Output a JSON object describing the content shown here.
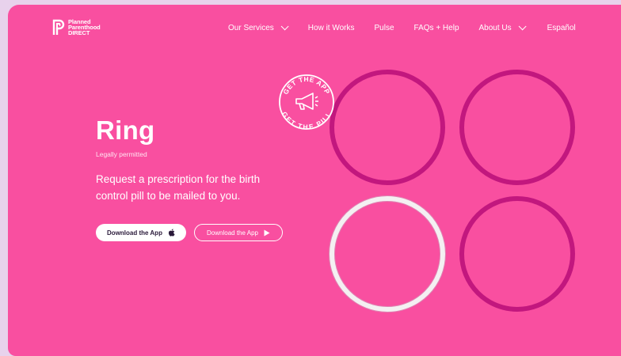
{
  "brand": {
    "line1": "Planned",
    "line2": "Parenthood",
    "line3": "DIRECT"
  },
  "nav": [
    {
      "label": "Our Services",
      "dropdown": true
    },
    {
      "label": "How it Works",
      "dropdown": false
    },
    {
      "label": "Pulse",
      "dropdown": false
    },
    {
      "label": "FAQs + Help",
      "dropdown": false
    },
    {
      "label": "About Us",
      "dropdown": true
    },
    {
      "label": "Español",
      "dropdown": false
    }
  ],
  "hero": {
    "title": "Ring",
    "subtitle": "Legally permitted",
    "description": "Request a prescription for the birth control pill to be mailed to you."
  },
  "buttons": {
    "ios": "Download the App",
    "android": "Download the App"
  },
  "badge": {
    "top_text": "GET THE APP",
    "bottom_text": "GET THE PILL"
  },
  "colors": {
    "background": "#f94fa0",
    "ring": "#c2177e",
    "ring_selected": "#f4f0f2"
  },
  "icons": [
    "apple-icon",
    "play-icon",
    "megaphone-icon",
    "chevron-down-icon"
  ]
}
